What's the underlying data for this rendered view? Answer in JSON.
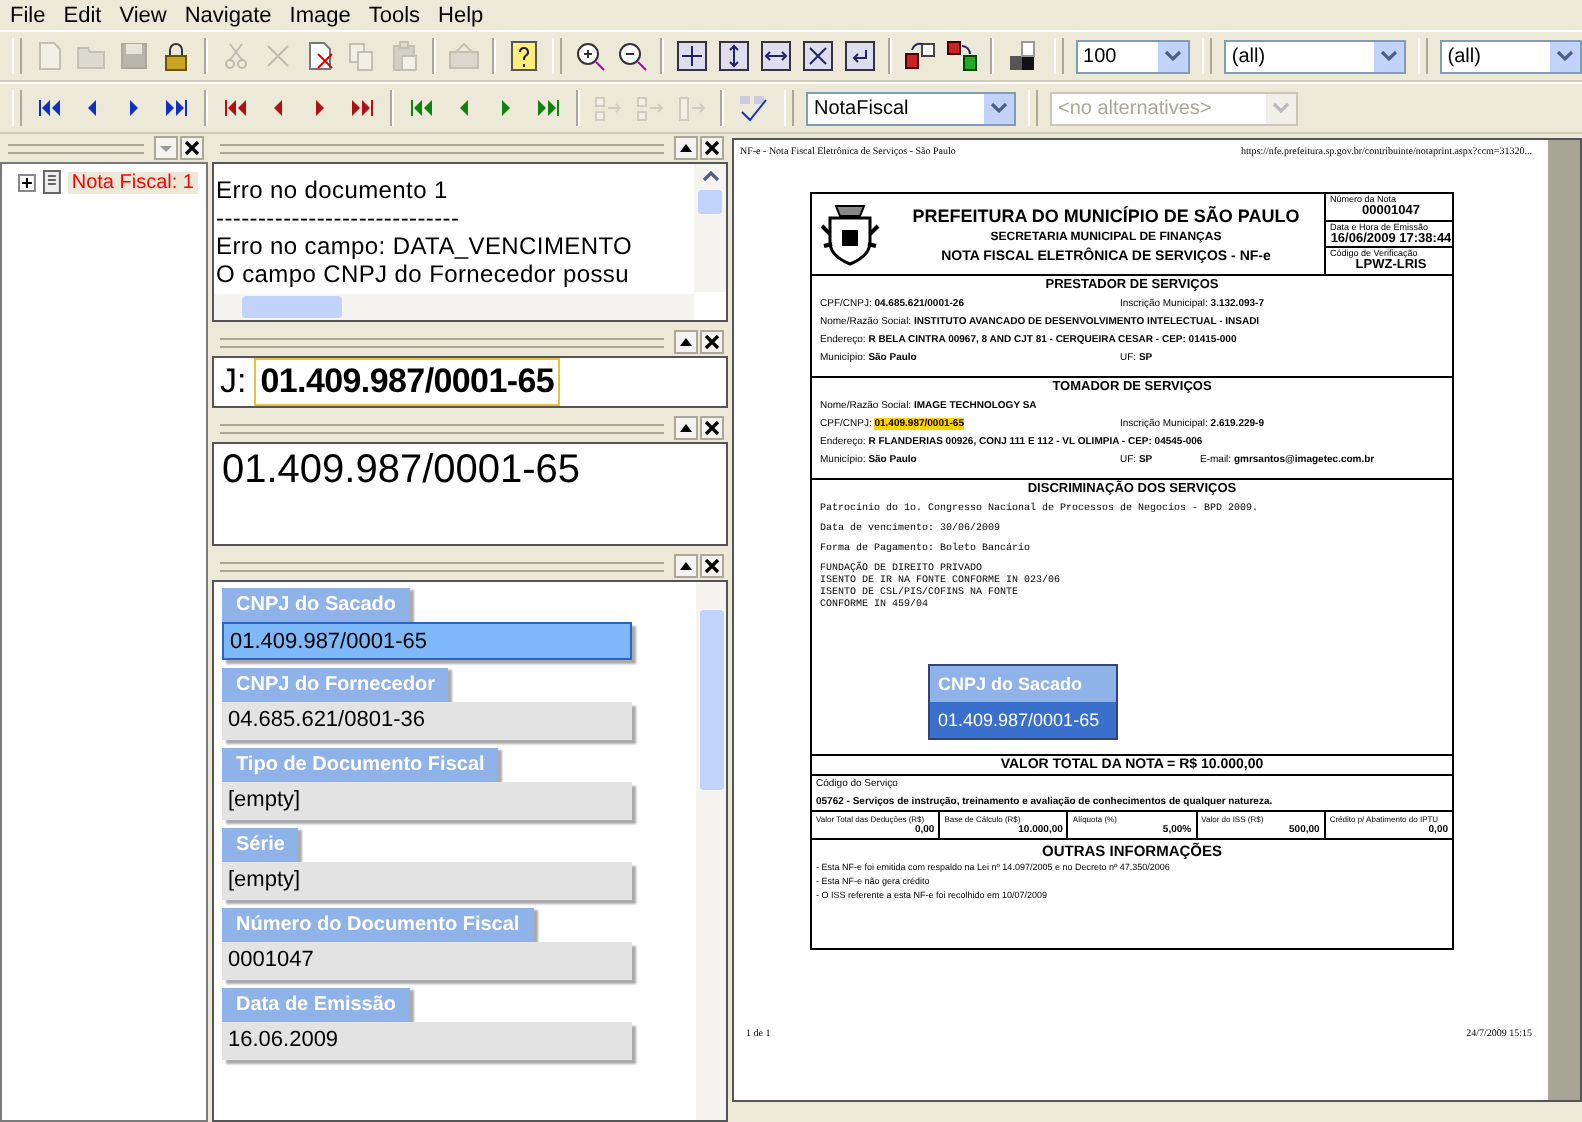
{
  "menu": [
    {
      "label": "File"
    },
    {
      "label": "Edit"
    },
    {
      "label": "View"
    },
    {
      "label": "Navigate"
    },
    {
      "label": "Image"
    },
    {
      "label": "Tools"
    },
    {
      "label": "Help"
    }
  ],
  "toolbar_1": [
    {
      "disabled": true
    },
    {
      "disabled": true
    },
    {
      "disabled": true
    },
    {
      "disabled": false
    },
    {
      "disabled": true
    },
    {
      "disabled": true
    },
    {
      "disabled": false
    },
    {
      "disabled": true
    },
    {
      "disabled": true
    },
    {
      "disabled": true
    },
    {
      "disabled": false
    },
    {
      "disabled": false
    },
    {
      "disabled": false
    },
    {
      "disabled": false
    },
    {
      "disabled": false
    },
    {
      "disabled": false
    },
    {
      "disabled": false
    },
    {
      "disabled": false
    },
    {
      "disabled": false
    },
    {
      "disabled": false
    },
    {
      "disabled": false
    }
  ],
  "zoom_combo": {
    "value": "100"
  },
  "filter_combos": [
    {
      "value": "(all)"
    },
    {
      "value": "(all)"
    }
  ],
  "toolbar_2": [
    {
      "disabled": false
    },
    {
      "disabled": false
    },
    {
      "disabled": false
    },
    {
      "disabled": false
    },
    {
      "disabled": false
    },
    {
      "disabled": false
    },
    {
      "disabled": false
    },
    {
      "disabled": false
    },
    {
      "disabled": false
    },
    {
      "disabled": false
    },
    {
      "disabled": false
    },
    {
      "disabled": false
    },
    {
      "disabled": true
    },
    {
      "disabled": true
    },
    {
      "disabled": true
    },
    {
      "disabled": false
    }
  ],
  "doc_type_combo": {
    "value": "NotaFiscal",
    "disabled": false
  },
  "alternatives_combo": {
    "value": "<no alternatives>",
    "disabled": true
  },
  "tree": [
    {
      "label": "Nota Fiscal: 1",
      "expanded": false,
      "has_error": true
    }
  ],
  "errors": [
    "Erro no documento 1",
    "-----------------------------",
    "Erro no campo: DATA_VENCIMENTO",
    "O campo CNPJ do Fornecedor possu"
  ],
  "snippet": {
    "prefix": "J:",
    "value": "01.409.987/0001-65"
  },
  "recognized_value": "01.409.987/0001-65",
  "fields": [
    {
      "label": "CNPJ do Sacado",
      "value": "01.409.987/0001-65",
      "selected": true
    },
    {
      "label": "CNPJ do Fornecedor",
      "value": "04.685.621/0801-36",
      "selected": false
    },
    {
      "label": "Tipo de Documento Fiscal",
      "value": "[empty]",
      "selected": false
    },
    {
      "label": "Série",
      "value": "[empty]",
      "selected": false
    },
    {
      "label": "Número do Documento Fiscal",
      "value": "0001047",
      "selected": false
    },
    {
      "label": "Data de Emissão",
      "value": "16.06.2009",
      "selected": false
    }
  ],
  "document": {
    "page_title": "NF-e - Nota Fiscal Eletrônica de Serviços - São Paulo",
    "page_url": "https://nfe.prefeitura.sp.gov.br/contribuinte/notaprint.aspx?ccm=31320...",
    "title": "PREFEITURA DO MUNICÍPIO DE SÃO PAULO",
    "subtitle": "SECRETARIA MUNICIPAL DE FINANÇAS",
    "doc_title": "NOTA FISCAL ELETRÔNICA DE SERVIÇOS - NF-e",
    "info": [
      {
        "label": "Número da Nota",
        "value": "00001047"
      },
      {
        "label": "Data e Hora de Emissão",
        "value": "16/06/2009 17:38:44"
      },
      {
        "label": "Código de Verificação",
        "value": "LPWZ-LRIS"
      }
    ],
    "sections": [
      {
        "heading": "PRESTADOR DE SERVIÇOS",
        "rows": [
          [
            {
              "label": "CPF/CNPJ:",
              "value": "04.685.621/0001-26",
              "highlighted": false
            },
            {
              "label": "Inscrição Municipal:",
              "value": "3.132.093-7",
              "highlighted": false
            }
          ],
          [
            {
              "label": "Nome/Razão Social:",
              "value": "INSTITUTO AVANCADO DE DESENVOLVIMENTO INTELECTUAL - INSADI",
              "highlighted": false
            }
          ],
          [
            {
              "label": "Endereço:",
              "value": "R BELA CINTRA 00967, 8 AND CJT 81 - CERQUEIRA CESAR - CEP: 01415-000",
              "highlighted": false
            }
          ],
          [
            {
              "label": "Município:",
              "value": "São Paulo",
              "highlighted": false
            },
            {
              "label": "UF:",
              "value": "SP",
              "highlighted": false
            }
          ]
        ]
      },
      {
        "heading": "TOMADOR DE SERVIÇOS",
        "rows": [
          [
            {
              "label": "Nome/Razão Social:",
              "value": "IMAGE TECHNOLOGY SA",
              "highlighted": false
            }
          ],
          [
            {
              "label": "CPF/CNPJ:",
              "value": "01.409.987/0001-65",
              "highlighted": true
            },
            {
              "label": "Inscrição Municipal:",
              "value": "2.619.229-9",
              "highlighted": false
            }
          ],
          [
            {
              "label": "Endereço:",
              "value": "R FLANDERIAS 00926, CONJ 111 E 112 - VL OLIMPIA - CEP: 04545-006",
              "highlighted": false
            }
          ],
          [
            {
              "label": "Município:",
              "value": "São Paulo",
              "highlighted": false
            },
            {
              "label": "UF:",
              "value": "SP",
              "highlighted": false
            },
            {
              "label": "E-mail:",
              "value": "gmrsantos@imagetec.com.br",
              "highlighted": false
            }
          ]
        ]
      }
    ],
    "services_heading": "DISCRIMINAÇÃO DOS SERVIÇOS",
    "services_lines": [
      "Patrocinio do 1o. Congresso Nacional de Processos de Negocios - BPD 2009.",
      "Data de vencimento: 30/06/2009",
      "Forma de Pagamento: Boleto Bancário"
    ],
    "services_notes": [
      "FUNDAÇÃO DE DIREITO PRIVADO",
      "ISENTO DE IR NA FONTE CONFORME IN 023/06",
      "ISENTO DE CSL/PIS/COFINS NA FONTE",
      "CONFORME IN 459/04"
    ],
    "overlay": {
      "label": "CNPJ do Sacado",
      "value": "01.409.987/0001-65"
    },
    "total": "VALOR TOTAL DA NOTA = R$ 10.000,00",
    "service_code_label": "Código do Serviço",
    "service_code": "05762 - Serviços de instrução, treinamento e avaliação de conhecimentos de qualquer natureza.",
    "taxes": [
      {
        "label": "Valor Total das Deduções (R$)",
        "value": "0,00"
      },
      {
        "label": "Base de Cálculo (R$)",
        "value": "10.000,00"
      },
      {
        "label": "Alíquota (%)",
        "value": "5,00%"
      },
      {
        "label": "Valor do ISS (R$)",
        "value": "500,00"
      },
      {
        "label": "Crédito p/ Abatimento do IPTU",
        "value": "0,00"
      }
    ],
    "other_heading": "OUTRAS INFORMAÇÕES",
    "other_lines": [
      "- Esta NF-e foi emitida com respaldo na Lei nº 14.097/2005 e no Decreto nº 47.350/2006",
      "- Esta NF-e não gera crédito",
      "- O ISS referente a esta NF-e foi recolhido em 10/07/2009"
    ],
    "footer_left": "1 de 1",
    "footer_right": "24/7/2009 15:15"
  }
}
